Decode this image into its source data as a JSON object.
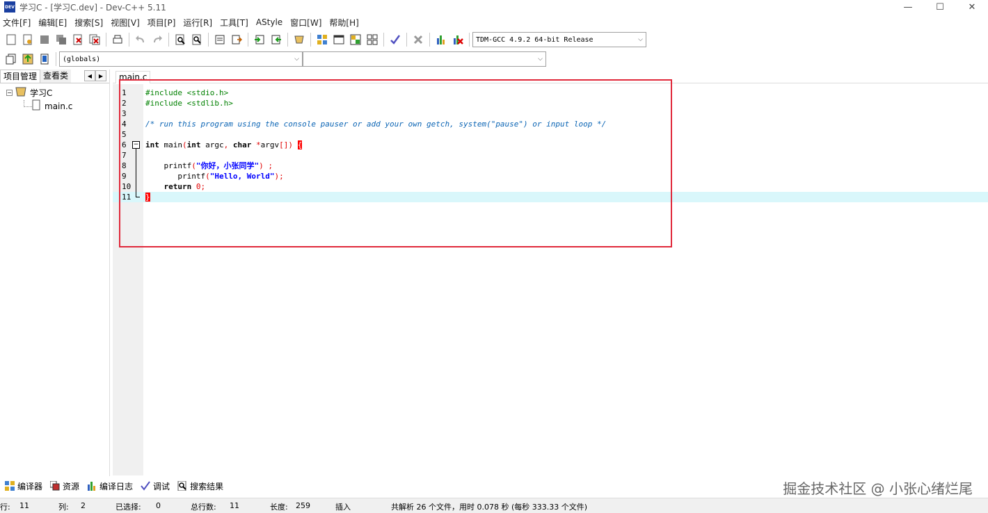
{
  "window": {
    "title": "学习C - [学习C.dev] - Dev-C++ 5.11",
    "icon_label": "DEV"
  },
  "menu": [
    "文件[F]",
    "编辑[E]",
    "搜索[S]",
    "视图[V]",
    "项目[P]",
    "运行[R]",
    "工具[T]",
    "AStyle",
    "窗口[W]",
    "帮助[H]"
  ],
  "toolbar": {
    "compiler_select": "TDM-GCC 4.9.2 64-bit Release",
    "scope_select": "(globals)",
    "function_select": ""
  },
  "left_panel": {
    "tabs": [
      "项目管理",
      "查看类"
    ],
    "tree": {
      "project": "学习C",
      "file": "main.c"
    }
  },
  "editor": {
    "tab": "main.c",
    "lines": [
      {
        "n": "1",
        "text": "#include <stdio.h>"
      },
      {
        "n": "2",
        "text": "#include <stdlib.h>"
      },
      {
        "n": "3",
        "text": ""
      },
      {
        "n": "4",
        "text": "/* run this program using the console pauser or add your own getch, system(\"pause\") or input loop */"
      },
      {
        "n": "5",
        "text": ""
      },
      {
        "n": "6",
        "text": "int main(int argc, char *argv[]) {"
      },
      {
        "n": "7",
        "text": ""
      },
      {
        "n": "8",
        "text": "    printf(\"你好，小张同学\") ;"
      },
      {
        "n": "9",
        "text": "       printf(\"Hello, World\");"
      },
      {
        "n": "10",
        "text": "    return 0;"
      },
      {
        "n": "11",
        "text": "}"
      }
    ],
    "highlighted_line": "11"
  },
  "bottom_tabs": [
    "编译器",
    "资源",
    "编译日志",
    "调试",
    "搜索结果"
  ],
  "watermark": "掘金技术社区 @ 小张心绪烂尾",
  "status": {
    "row_label": "行:",
    "row_value": "11",
    "col_label": "列:",
    "col_value": "2",
    "sel_label": "已选择:",
    "sel_value": "0",
    "total_label": "总行数:",
    "total_value": "11",
    "len_label": "长度:",
    "len_value": "259",
    "mode": "插入",
    "message": "共解析 26 个文件，用时 0.078 秒 (每秒 333.33 个文件)"
  },
  "colors": {
    "highlight_line": "#d9f7fb",
    "annotation_box": "#e0283a",
    "preprocessor": "#008000",
    "comment": "#0a64b4",
    "string": "#0000ff",
    "number": "#e00000"
  }
}
